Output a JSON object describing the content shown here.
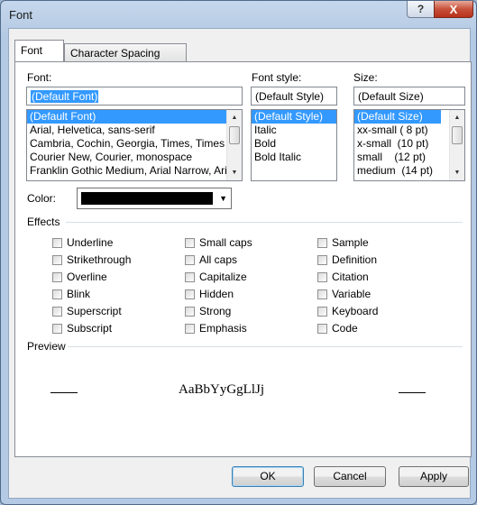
{
  "window": {
    "title": "Font",
    "help_label": "?",
    "close_label": "X"
  },
  "tabs": [
    {
      "label": "Font"
    },
    {
      "label": "Character Spacing"
    }
  ],
  "font": {
    "label": "Font:",
    "value": "(Default Font)",
    "options": [
      "(Default Font)",
      "Arial, Helvetica, sans-serif",
      "Cambria, Cochin, Georgia, Times, Times New Roman, serif",
      "Courier New, Courier, monospace",
      "Franklin Gothic Medium, Arial Narrow, Arial, sans-serif"
    ]
  },
  "style": {
    "label": "Font style:",
    "value": "(Default Style)",
    "options": [
      "(Default Style)",
      "Italic",
      "Bold",
      "Bold Italic"
    ]
  },
  "size": {
    "label": "Size:",
    "value": "(Default Size)",
    "options": [
      "(Default Size)",
      "xx-small ( 8 pt)",
      "x-small  (10 pt)",
      "small    (12 pt)",
      "medium  (14 pt)"
    ]
  },
  "color": {
    "label": "Color:",
    "value": "#000000"
  },
  "effects": {
    "label": "Effects",
    "columns": [
      [
        "Underline",
        "Strikethrough",
        "Overline",
        "Blink",
        "Superscript",
        "Subscript"
      ],
      [
        "Small caps",
        "All caps",
        "Capitalize",
        "Hidden",
        "Strong",
        "Emphasis"
      ],
      [
        "Sample",
        "Definition",
        "Citation",
        "Variable",
        "Keyboard",
        "Code"
      ]
    ]
  },
  "preview": {
    "label": "Preview",
    "sample": "AaBbYyGgLlJj"
  },
  "buttons": {
    "ok": "OK",
    "cancel": "Cancel",
    "apply": "Apply"
  },
  "colors": {
    "selection": "#3399ff",
    "title_bar": "#b4c9e3"
  }
}
